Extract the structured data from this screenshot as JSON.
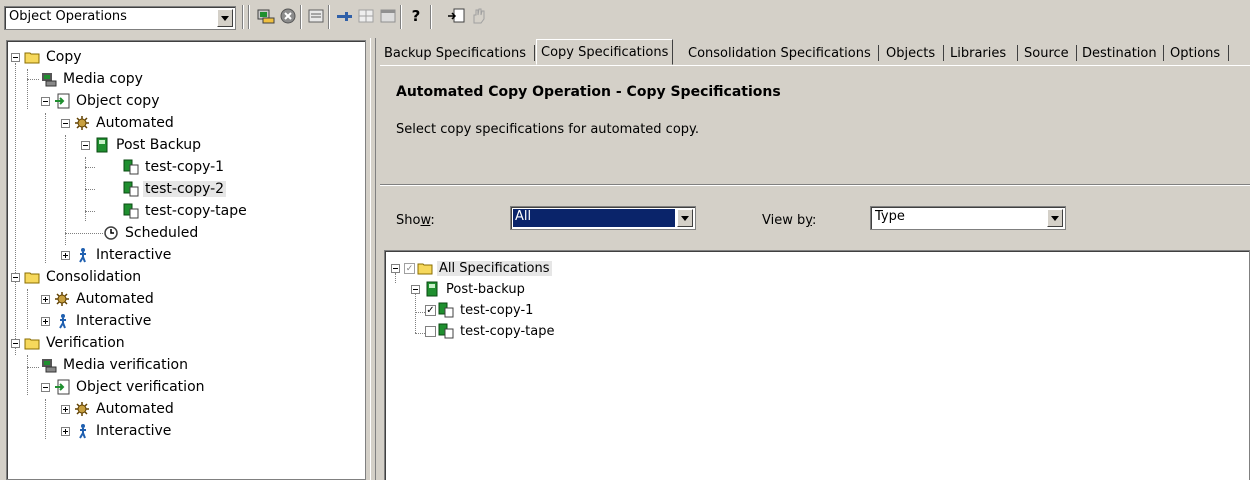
{
  "toolbar": {
    "object_combo_value": "Object Operations",
    "icons": [
      "report-icon",
      "stop-icon",
      "list-icon",
      "pin-icon",
      "grid-icon",
      "table-icon",
      "help-icon",
      "goto-icon",
      "hand-icon"
    ],
    "help_glyph": "?"
  },
  "tree": {
    "copy": "Copy",
    "media_copy": "Media copy",
    "object_copy": "Object copy",
    "automated": "Automated",
    "post_backup": "Post Backup",
    "test_copy_1": "test-copy-1",
    "test_copy_2": "test-copy-2",
    "test_copy_tape": "test-copy-tape",
    "scheduled": "Scheduled",
    "interactive": "Interactive",
    "consolidation": "Consolidation",
    "cons_automated": "Automated",
    "cons_interactive": "Interactive",
    "verification": "Verification",
    "media_verification": "Media verification",
    "object_verification": "Object verification",
    "ver_automated": "Automated",
    "ver_interactive": "Interactive"
  },
  "tabs": [
    {
      "label": "Backup Specifications"
    },
    {
      "label": "Copy Specifications",
      "active": true
    },
    {
      "label": "Consolidation Specifications"
    },
    {
      "label": "Objects"
    },
    {
      "label": "Libraries"
    },
    {
      "label": "Source"
    },
    {
      "label": "Destination"
    },
    {
      "label": "Options"
    }
  ],
  "content": {
    "title": "Automated Copy Operation - Copy Specifications",
    "description": "Select copy specifications for automated copy.",
    "show_label_pre": "Sho",
    "show_label_u": "w",
    "show_label_post": ":",
    "show_value": "All",
    "viewby_label_pre": "View b",
    "viewby_label_u": "y",
    "viewby_label_post": ":",
    "viewby_value": "Type"
  },
  "spec_tree": {
    "all_specifications": "All Specifications",
    "post_backup": "Post-backup",
    "test_copy_1": "test-copy-1",
    "test_copy_1_checked": true,
    "test_copy_tape": "test-copy-tape",
    "test_copy_tape_checked": false,
    "checkmark": "✓"
  },
  "colors": {
    "window_bg": "#d4d0c8",
    "selection_blue": "#0a246a",
    "folder_yellow": "#f6d85c",
    "green_doc": "#1f8f2f"
  }
}
